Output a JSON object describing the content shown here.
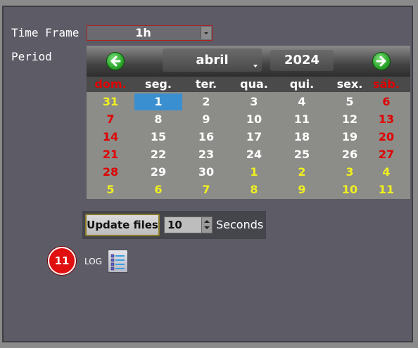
{
  "labels": {
    "time_frame": "Time Frame",
    "period": "Period"
  },
  "time_frame_select": {
    "value": "1h"
  },
  "calendar": {
    "month": "abril",
    "year": "2024",
    "weekdays": [
      "dom.",
      "seg.",
      "ter.",
      "qua.",
      "qui.",
      "sex.",
      "sáb."
    ],
    "weeks": [
      [
        "31",
        "1",
        "2",
        "3",
        "4",
        "5",
        "6"
      ],
      [
        "7",
        "8",
        "9",
        "10",
        "11",
        "12",
        "13"
      ],
      [
        "14",
        "15",
        "16",
        "17",
        "18",
        "19",
        "20"
      ],
      [
        "21",
        "22",
        "23",
        "24",
        "25",
        "26",
        "27"
      ],
      [
        "28",
        "29",
        "30",
        "1",
        "2",
        "3",
        "4"
      ],
      [
        "5",
        "6",
        "7",
        "8",
        "9",
        "10",
        "11"
      ]
    ],
    "selected_day": "1"
  },
  "update": {
    "button_label": "Update files",
    "interval_value": "10",
    "unit_label": "Seconds"
  },
  "log": {
    "badge_count": "11",
    "label": "LOG"
  },
  "colors": {
    "accent": "#3a8fd0",
    "weekend": "#e00000",
    "other_month": "#f0f020",
    "badge": "#e01010"
  }
}
